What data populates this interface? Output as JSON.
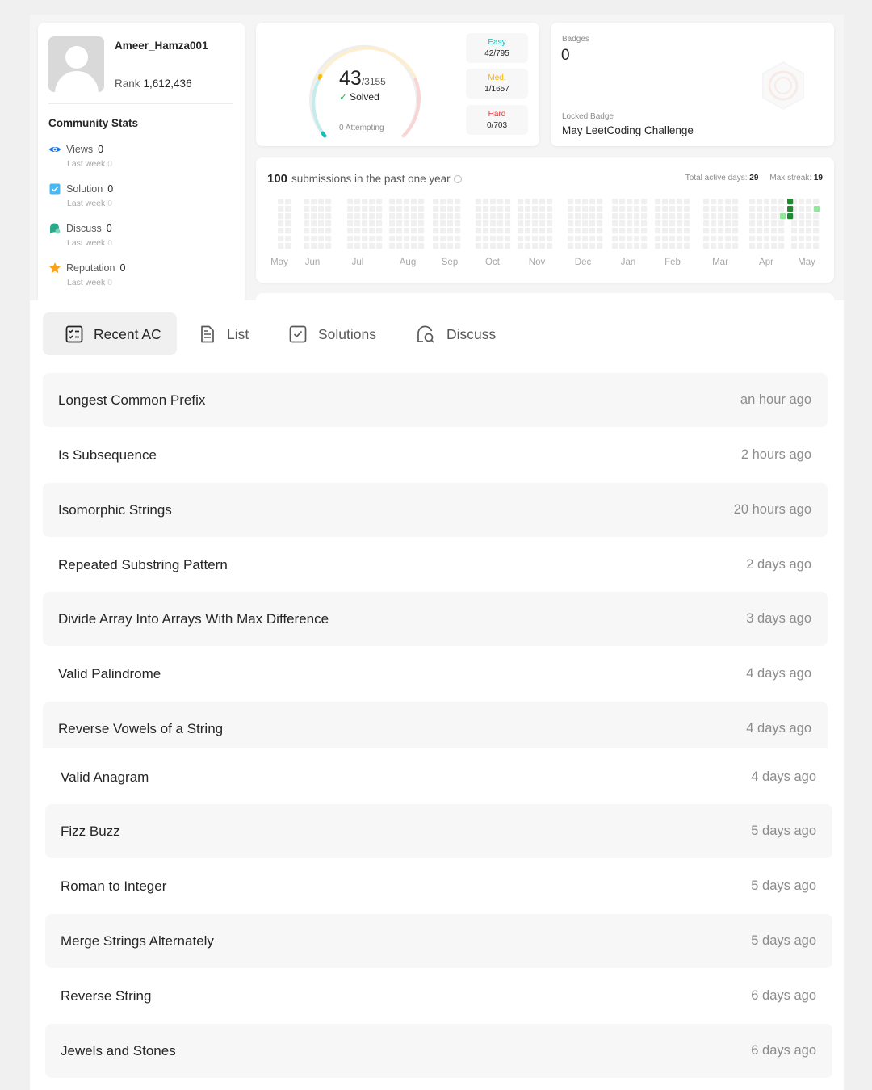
{
  "profile": {
    "username": "Ameer_Hamza001",
    "rank_label": "Rank",
    "rank_value": "1,612,436"
  },
  "community": {
    "title": "Community Stats",
    "stats": [
      {
        "icon": "eye-icon",
        "label": "Views",
        "value": "0",
        "sub_label": "Last week",
        "sub_value": "0",
        "color": "#1a73e8"
      },
      {
        "icon": "check-square-icon",
        "label": "Solution",
        "value": "0",
        "sub_label": "Last week",
        "sub_value": "0",
        "color": "#45b8f5"
      },
      {
        "icon": "chat-icon",
        "label": "Discuss",
        "value": "0",
        "sub_label": "Last week",
        "sub_value": "0",
        "color": "#2aa889"
      },
      {
        "icon": "star-icon",
        "label": "Reputation",
        "value": "0",
        "sub_label": "Last week",
        "sub_value": "0",
        "color": "#ffa116"
      }
    ]
  },
  "solved": {
    "count": "43",
    "total": "/3155",
    "label": "Solved",
    "attempting": "0 Attempting",
    "difficulties": [
      {
        "name": "Easy",
        "value": "42/795",
        "color": "#1cbbba"
      },
      {
        "name": "Med.",
        "value": "1/1657",
        "color": "#ffb700"
      },
      {
        "name": "Hard",
        "value": "0/703",
        "color": "#f63737"
      }
    ]
  },
  "badges": {
    "label": "Badges",
    "count": "0",
    "locked_label": "Locked Badge",
    "locked_name": "May LeetCoding Challenge"
  },
  "heatmap": {
    "count": "100",
    "title": "submissions in the past one year",
    "active_days_label": "Total active days:",
    "active_days": "29",
    "max_streak_label": "Max streak:",
    "max_streak": "19",
    "months": [
      "May",
      "Jun",
      "Jul",
      "Aug",
      "Sep",
      "Oct",
      "Nov",
      "Dec",
      "Jan",
      "Feb",
      "Mar",
      "Apr",
      "May"
    ]
  },
  "tabs": [
    {
      "label": "Recent AC",
      "icon": "checklist-icon",
      "active": true
    },
    {
      "label": "List",
      "icon": "document-icon",
      "active": false
    },
    {
      "label": "Solutions",
      "icon": "check-square-icon",
      "active": false
    },
    {
      "label": "Discuss",
      "icon": "chat-search-icon",
      "active": false
    }
  ],
  "recent": [
    {
      "title": "Longest Common Prefix",
      "time": "an hour ago"
    },
    {
      "title": "Is Subsequence",
      "time": "2 hours ago"
    },
    {
      "title": "Isomorphic Strings",
      "time": "20 hours ago"
    },
    {
      "title": "Repeated Substring Pattern",
      "time": "2 days ago"
    },
    {
      "title": "Divide Array Into Arrays With Max Difference",
      "time": "3 days ago"
    },
    {
      "title": "Valid Palindrome",
      "time": "4 days ago"
    },
    {
      "title": "Reverse Vowels of a String",
      "time": "4 days ago"
    },
    {
      "title": "Valid Anagram",
      "time": "4 days ago"
    },
    {
      "title": "Fizz Buzz",
      "time": "5 days ago"
    },
    {
      "title": "Roman to Integer",
      "time": "5 days ago"
    },
    {
      "title": "Merge Strings Alternately",
      "time": "5 days ago"
    },
    {
      "title": "Reverse String",
      "time": "6 days ago"
    },
    {
      "title": "Jewels and Stones",
      "time": "6 days ago"
    }
  ]
}
